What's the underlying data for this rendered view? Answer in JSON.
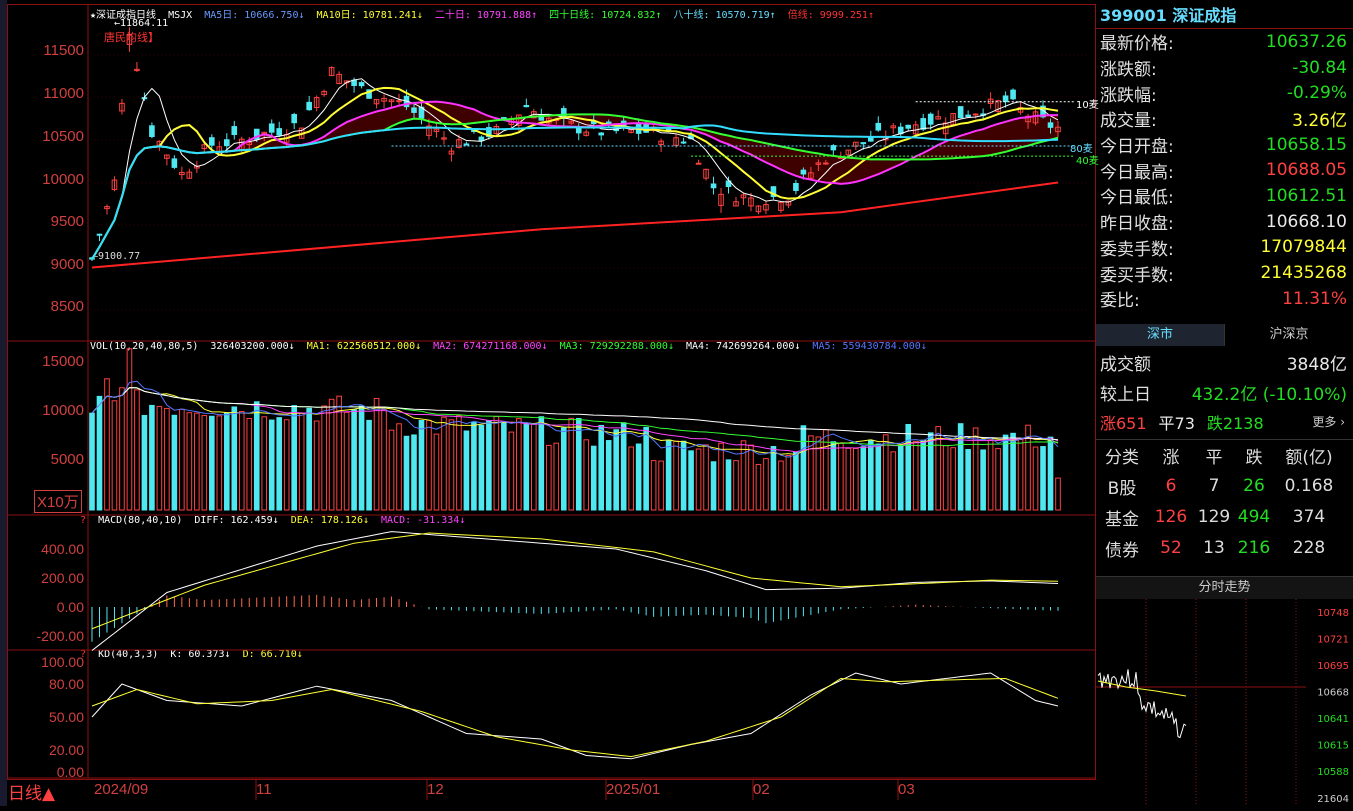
{
  "chart_header": {
    "title": "★深证成指日线",
    "indicator": "MSJX",
    "ma5": "MA5日: 10666.750↓",
    "ma10": "MA10日: 10781.241↓",
    "ma20": "二十日: 10791.888↑",
    "ma40": "四十日线: 10724.832↑",
    "ma80": "八十线: 10570.719↑",
    "beixian": "倍线: 9999.251↑",
    "high_marker": "←11864.11",
    "legend_box": "唐民均线】",
    "low_marker": "←9100.77",
    "label_10": "10麦",
    "label_80": "80麦",
    "label_40": "40麦"
  },
  "price_axis": [
    "11500",
    "11000",
    "10500",
    "10000",
    "9500",
    "9000",
    "8500"
  ],
  "vol_header": {
    "title": "VOL(10,20,40,80,5)",
    "vol": "326403200.000↓",
    "ma1": "MA1: 622560512.000↓",
    "ma2": "MA2: 674271168.000↓",
    "ma3": "MA3: 729292288.000↓",
    "ma4": "MA4: 742699264.000↓",
    "ma5": "MA5: 559430784.000↓"
  },
  "vol_axis": [
    "15000",
    "10000",
    "5000"
  ],
  "vol_unit": "X10万",
  "macd_header": {
    "title": "MACD(80,40,10)",
    "diff": "DIFF: 162.459↓",
    "dea": "DEA: 178.126↓",
    "macd": "MACD: -31.334↓"
  },
  "macd_axis": [
    "400.00",
    "200.00",
    "0.00",
    "-200.00"
  ],
  "kd_header": {
    "title": "KD(40,3,3)",
    "k": "K: 60.373↓",
    "d": "D: 66.710↓"
  },
  "kd_axis": [
    "100.00",
    "80.00",
    "50.00",
    "20.00",
    "0.00"
  ],
  "period_label": "日线▲",
  "x_labels": [
    "2024/09",
    "11",
    "12",
    "2025/01",
    "02",
    "03"
  ],
  "quote": {
    "code_name": "399001 深证成指",
    "rows": [
      {
        "label": "最新价格:",
        "value": "10637.26",
        "color": "green"
      },
      {
        "label": "涨跌额:",
        "value": "-30.84",
        "color": "green"
      },
      {
        "label": "涨跌幅:",
        "value": "-0.29%",
        "color": "green"
      },
      {
        "label": "成交量:",
        "value": "3.26亿",
        "color": "yellow"
      },
      {
        "label": "今日开盘:",
        "value": "10658.15",
        "color": "green"
      },
      {
        "label": "今日最高:",
        "value": "10688.05",
        "color": "red"
      },
      {
        "label": "今日最低:",
        "value": "10612.51",
        "color": "green"
      },
      {
        "label": "昨日收盘:",
        "value": "10668.10",
        "color": "white"
      },
      {
        "label": "委卖手数:",
        "value": "17079844",
        "color": "yellow"
      },
      {
        "label": "委买手数:",
        "value": "21435268",
        "color": "yellow"
      },
      {
        "label": "委比:",
        "value": "11.31%",
        "color": "red"
      }
    ]
  },
  "market_tabs": [
    "深市",
    "沪深京"
  ],
  "turnover": {
    "label": "成交额",
    "value": "3848亿"
  },
  "compare": {
    "label": "较上日",
    "value": "432.2亿 (-10.10%)"
  },
  "breadth": {
    "up": "涨651",
    "flat": "平73",
    "down": "跌2138",
    "more": "更多 ›"
  },
  "table": {
    "headers": [
      "分类",
      "涨",
      "平",
      "跌",
      "额(亿)"
    ],
    "rows": [
      {
        "name": "B股",
        "up": "6",
        "flat": "7",
        "down": "26",
        "amt": "0.168"
      },
      {
        "name": "基金",
        "up": "126",
        "flat": "129",
        "down": "494",
        "amt": "374"
      },
      {
        "name": "债券",
        "up": "52",
        "flat": "13",
        "down": "216",
        "amt": "228"
      }
    ]
  },
  "intraday": {
    "title": "分时走势",
    "axis": [
      "10748",
      "10721",
      "10695",
      "10668",
      "10641",
      "10615",
      "10588",
      "21604"
    ]
  },
  "colors": {
    "up": "#ff4040",
    "down": "#4fe8f0",
    "frame": "#8b1010",
    "ma5": "#ffffff",
    "ma10": "#ffff33",
    "ma20": "#ff33ff",
    "ma40": "#33ff33",
    "ma80": "#33ddff",
    "beixian": "#ff2222"
  }
}
